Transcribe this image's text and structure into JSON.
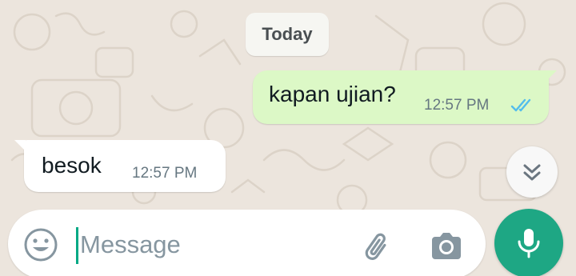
{
  "colors": {
    "wallpaper": "#ece5dd",
    "outgoing_bubble": "#dcf8c6",
    "incoming_bubble": "#ffffff",
    "read_ticks": "#53bdeb",
    "accent": "#1ea784"
  },
  "date_separator": "Today",
  "messages": [
    {
      "direction": "outgoing",
      "text": "kapan ujian?",
      "time": "12:57 PM",
      "status_icon": "double-check-read-icon"
    },
    {
      "direction": "incoming",
      "text": "besok",
      "time": "12:57 PM"
    }
  ],
  "composer": {
    "placeholder": "Message",
    "value": "",
    "icons": {
      "emoji": "emoji-icon",
      "attach": "paperclip-icon",
      "camera": "camera-icon",
      "send": "microphone-icon"
    }
  },
  "scroll_button_icon": "double-chevron-down-icon"
}
